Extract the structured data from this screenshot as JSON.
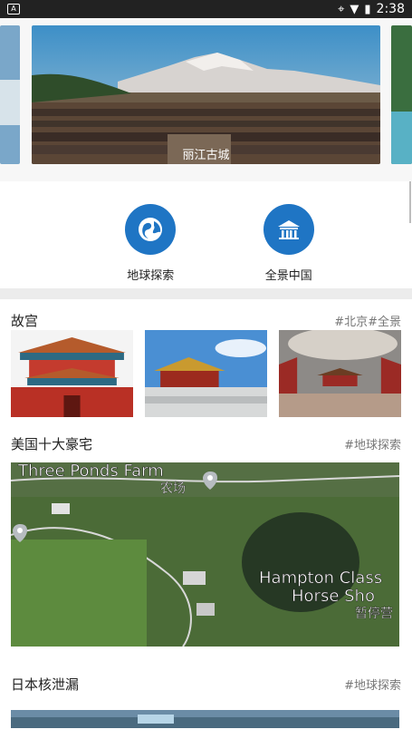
{
  "status_bar": {
    "time": "2:38"
  },
  "carousel": {
    "caption": "丽江古城"
  },
  "quick_links": [
    {
      "label": "地球探索",
      "icon": "globe-icon"
    },
    {
      "label": "全景中国",
      "icon": "temple-icon"
    }
  ],
  "sections": [
    {
      "title": "故宫",
      "tag": "#北京#全景"
    },
    {
      "title": "美国十大豪宅",
      "tag": "#地球探索"
    },
    {
      "title": "日本核泄漏",
      "tag": "#地球探索"
    }
  ],
  "map_labels": {
    "farm_en": "Three Ponds Farm",
    "farm_cn": "农场",
    "hampton_en1": "Hampton Class",
    "hampton_en2": "Horse Sho",
    "hampton_cn": "暂停营"
  },
  "colors": {
    "accent": "#1f75c4"
  }
}
